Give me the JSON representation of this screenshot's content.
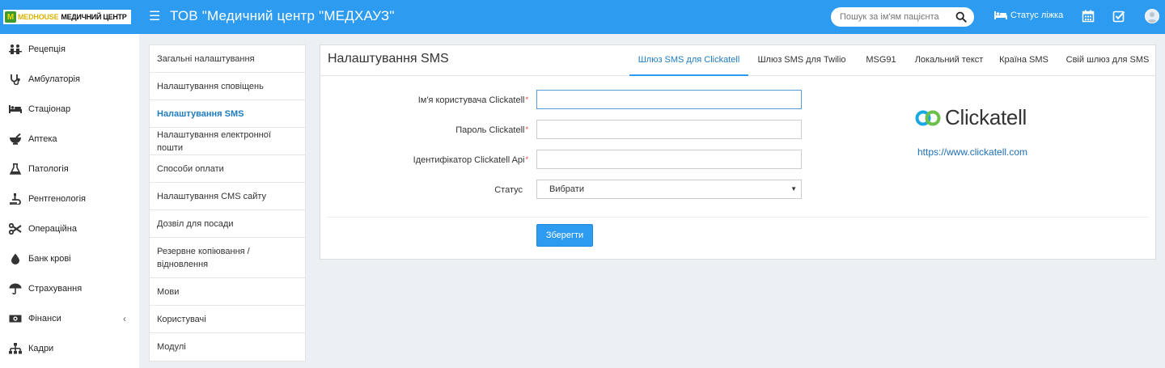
{
  "header": {
    "logo_brand": "MEDHOUSE",
    "logo_sub": "МЕДИЧНИЙ ЦЕНТР",
    "org_title": "ТОВ \"Медичний центр \"МЕДХАУЗ\"",
    "search_placeholder": "Пошук за ім'ям пацієнта",
    "bed_status": "Статус ліжка"
  },
  "sidebar": {
    "items": [
      {
        "label": "Рецепція",
        "icon": "reception-icon"
      },
      {
        "label": "Амбулаторія",
        "icon": "stethoscope-icon"
      },
      {
        "label": "Стаціонар",
        "icon": "bed-icon"
      },
      {
        "label": "Аптека",
        "icon": "mortar-icon"
      },
      {
        "label": "Патологія",
        "icon": "flask-icon"
      },
      {
        "label": "Рентгенологія",
        "icon": "xray-icon"
      },
      {
        "label": "Операційна",
        "icon": "scissors-icon"
      },
      {
        "label": "Банк крові",
        "icon": "drop-icon"
      },
      {
        "label": "Страхування",
        "icon": "umbrella-icon"
      },
      {
        "label": "Фінанси",
        "icon": "money-icon"
      },
      {
        "label": "Кадри",
        "icon": "org-chart-icon"
      }
    ]
  },
  "settings_menu": {
    "items": [
      "Загальні налаштування",
      "Налаштування сповіщень",
      "Налаштування SMS",
      "Налаштування електронної пошти",
      "Способи оплати",
      "Налаштування CMS сайту",
      "Дозвіл для посади",
      "Резервне копіювання / відновлення",
      "Мови",
      "Користувачі",
      "Модулі"
    ],
    "active_index": 2
  },
  "panel": {
    "title": "Налаштування SMS",
    "tabs": [
      "Шлюз SMS для Clickatell",
      "Шлюз SMS для Twilio",
      "MSG91",
      "Локальний текст",
      "Країна SMS",
      "Свій шлюз для SMS"
    ],
    "active_tab": 0
  },
  "form": {
    "username_label": "Ім'я користувача Clickatell",
    "username_value": "",
    "password_label": "Пароль Clickatell",
    "password_value": "",
    "api_label": "Ідентифікатор Clickatell Api",
    "api_value": "",
    "status_label": "Статус",
    "status_value": "Вибрати",
    "required_mark": "*",
    "save_label": "Зберегти"
  },
  "clickatell": {
    "logo_text": "Clickatell",
    "url": "https://www.clickatell.com"
  },
  "colors": {
    "header": "#2c9bf0",
    "accent": "#1f7cc0",
    "background": "#ecf0f5"
  }
}
